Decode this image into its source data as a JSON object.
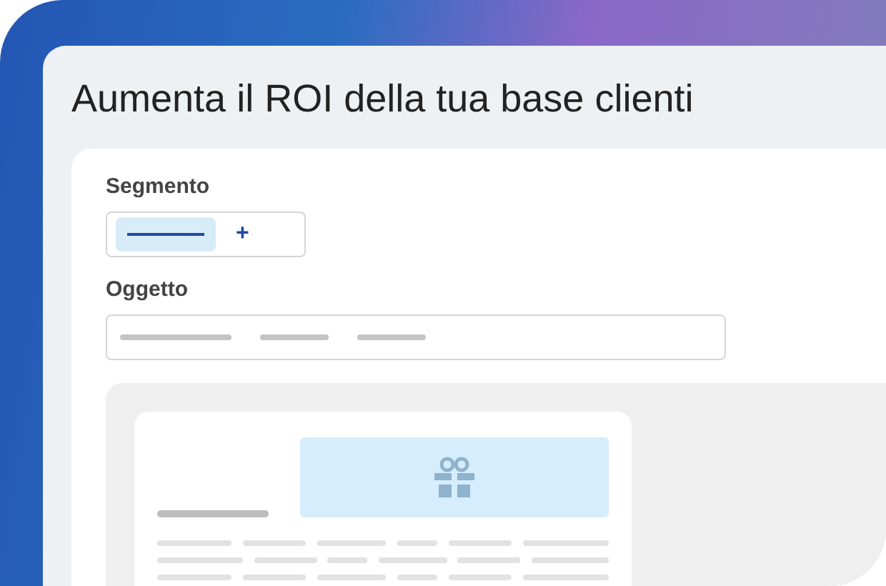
{
  "title": "Aumenta il ROI della tua base clienti",
  "segment": {
    "label": "Segmento",
    "add": "+"
  },
  "subject": {
    "label": "Oggetto"
  }
}
